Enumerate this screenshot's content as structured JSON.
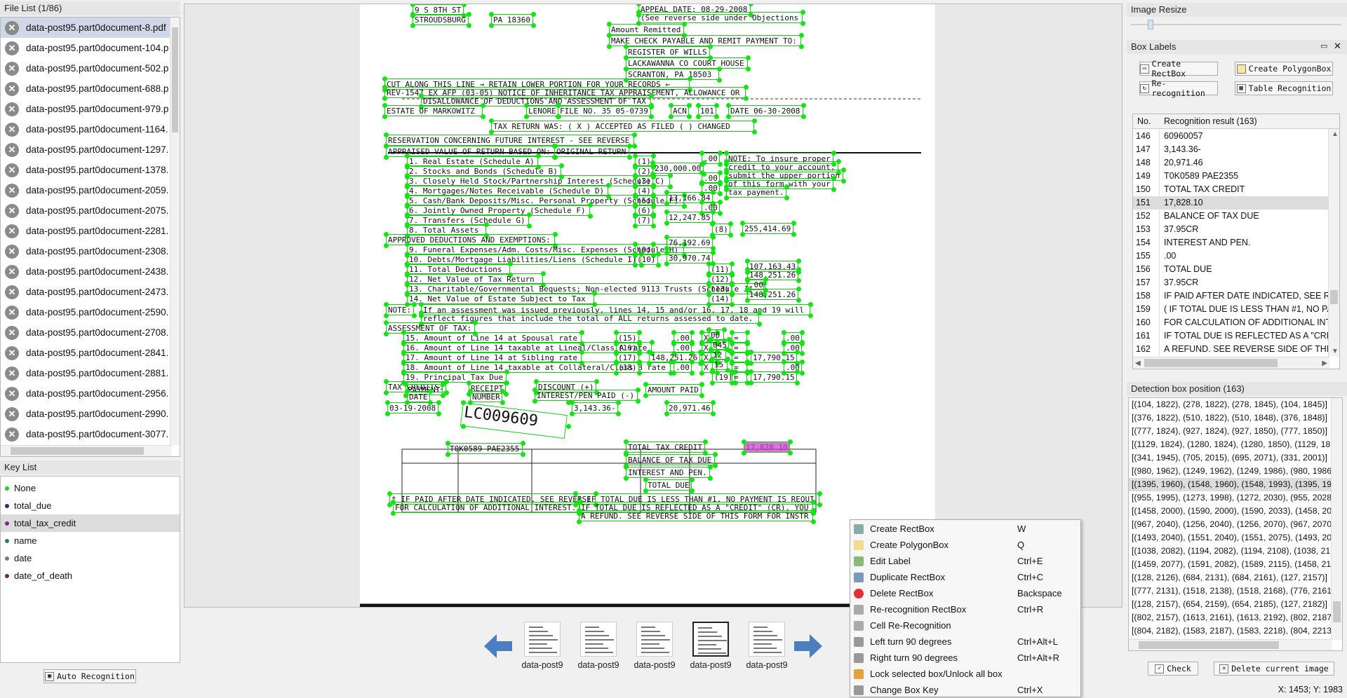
{
  "file_list": {
    "title": "File List (1/86)",
    "items": [
      "data-post95.part0document-8.pdf",
      "data-post95.part0document-104.p",
      "data-post95.part0document-502.p",
      "data-post95.part0document-688.p",
      "data-post95.part0document-979.p",
      "data-post95.part0document-1164.",
      "data-post95.part0document-1297.",
      "data-post95.part0document-1378.",
      "data-post95.part0document-2059.",
      "data-post95.part0document-2075.",
      "data-post95.part0document-2281.",
      "data-post95.part0document-2308.",
      "data-post95.part0document-2438.",
      "data-post95.part0document-2473.",
      "data-post95.part0document-2590.",
      "data-post95.part0document-2708.",
      "data-post95.part0document-2841.",
      "data-post95.part0document-2881.",
      "data-post95.part0document-2956.",
      "data-post95.part0document-2990.",
      "data-post95.part0document-3077."
    ]
  },
  "key_list": {
    "title": "Key List",
    "items": [
      {
        "label": "None",
        "color": "#22cc22"
      },
      {
        "label": "total_due",
        "color": "#2a2a7a"
      },
      {
        "label": "total_tax_credit",
        "color": "#7a2a7a"
      },
      {
        "label": "name",
        "color": "#2a7a7a"
      },
      {
        "label": "date",
        "color": "#7a7a7a"
      },
      {
        "label": "date_of_death",
        "color": "#7a2a2a"
      }
    ]
  },
  "auto_recognition": "Auto Recognition",
  "image_resize": {
    "title": "Image Resize"
  },
  "box_labels": {
    "title": "Box Labels",
    "create_rectbox": "Create RectBox",
    "create_polygonbox": "Create PolygonBox",
    "re_recognition": "Re-recognition",
    "table_recognition": "Table Recognition",
    "col_no": "No.",
    "col_result": "Recognition result (163)",
    "rows": [
      {
        "no": "146",
        "text": "60960057"
      },
      {
        "no": "147",
        "text": "3,143.36-"
      },
      {
        "no": "148",
        "text": "20,971.46"
      },
      {
        "no": "149",
        "text": "T0K0589 PAE2355"
      },
      {
        "no": "150",
        "text": "TOTAL TAX CREDIT"
      },
      {
        "no": "151",
        "text": "17,828.10"
      },
      {
        "no": "152",
        "text": "BALANCE OF TAX DUE"
      },
      {
        "no": "153",
        "text": "37.95CR"
      },
      {
        "no": "154",
        "text": "INTEREST AND PEN."
      },
      {
        "no": "155",
        "text": ".00"
      },
      {
        "no": "156",
        "text": "TOTAL DUE"
      },
      {
        "no": "157",
        "text": "37.95CR"
      },
      {
        "no": "158",
        "text": "IF PAID AFTER DATE INDICATED, SEE RE"
      },
      {
        "no": "159",
        "text": "( IF TOTAL DUE IS LESS THAN #1, NO PA"
      },
      {
        "no": "160",
        "text": "FOR CALCULATION OF ADDITIONAL INT"
      },
      {
        "no": "161",
        "text": "IF TOTAL DUE IS REFLECTED AS A \"CRED"
      },
      {
        "no": "162",
        "text": "A REFUND. SEE REVERSE SIDE OF THIS"
      }
    ]
  },
  "detection": {
    "title": "Detection box position (163)",
    "rows": [
      "[(104, 1822), (278, 1822), (278, 1845), (104, 1845)]",
      "[(376, 1822), (510, 1822), (510, 1848), (376, 1848)]",
      "[(777, 1824), (927, 1824), (927, 1850), (777, 1850)]",
      "[(1129, 1824), (1280, 1824), (1280, 1850), (1129, 18",
      "[(341, 1945), (705, 2015), (695, 2071), (331, 2001)]",
      "[(980, 1962), (1249, 1962), (1249, 1986), (980, 1986",
      "[(1395, 1960), (1548, 1960), (1548, 1993), (1395, 19",
      "[(955, 1995), (1273, 1998), (1272, 2030), (955, 2028",
      "[(1458, 2000), (1590, 2000), (1590, 2033), (1458, 20",
      "[(967, 2040), (1256, 2040), (1256, 2070), (967, 2070",
      "[(1493, 2040), (1551, 2040), (1551, 2075), (1493, 20",
      "[(1038, 2082), (1194, 2082), (1194, 2108), (1038, 21",
      "[(1459, 2077), (1591, 2082), (1589, 2115), (1458, 21",
      "[(128, 2126), (684, 2131), (684, 2161), (127, 2157)]",
      "[(777, 2131), (1518, 2138), (1518, 2168), (776, 2161",
      "[(128, 2157), (654, 2159), (654, 2185), (127, 2182)]",
      "[(802, 2157), (1613, 2161), (1613, 2192), (802, 2187",
      "[(804, 2182), (1583, 2187), (1583, 2218), (804, 2213"
    ]
  },
  "check_button": "Check",
  "delete_button": "Delete current image",
  "status": "X: 1453; Y: 1983",
  "thumbnails": [
    "data-post9",
    "data-post9",
    "data-post9",
    "data-post9",
    "data-post9"
  ],
  "context_menu": [
    {
      "label": "Create RectBox",
      "shortcut": "W",
      "icon": "rectbox-icon"
    },
    {
      "label": "Create PolygonBox",
      "shortcut": "Q",
      "icon": "polygon-icon"
    },
    {
      "label": "Edit Label",
      "shortcut": "Ctrl+E",
      "icon": "edit-icon"
    },
    {
      "label": "Duplicate RectBox",
      "shortcut": "Ctrl+C",
      "icon": "duplicate-icon"
    },
    {
      "label": "Delete RectBox",
      "shortcut": "Backspace",
      "icon": "delete-icon"
    },
    {
      "label": "Re-recognition RectBox",
      "shortcut": "Ctrl+R",
      "icon": "rerecognize-icon"
    },
    {
      "label": "Cell Re-Recognition",
      "shortcut": "",
      "icon": "cell-icon"
    },
    {
      "label": "Left turn 90 degrees",
      "shortcut": "Ctrl+Alt+L",
      "icon": "rotate-left-icon"
    },
    {
      "label": "Right turn 90 degrees",
      "shortcut": "Ctrl+Alt+R",
      "icon": "rotate-right-icon"
    },
    {
      "label": "Lock selected box/Unlock all box",
      "shortcut": "",
      "icon": "lock-icon"
    },
    {
      "label": "Change Box Key",
      "shortcut": "Ctrl+X",
      "icon": "key-icon"
    }
  ],
  "document": {
    "lines": [
      "9 S 8TH ST",
      "STROUDSBURG",
      "PA 18360",
      "APPEAL DATE: 08-29-2008",
      "(See reverse side under Objections",
      "Amount Remitted",
      "MAKE CHECK PAYABLE AND REMIT PAYMENT TO:",
      "REGISTER OF WILLS",
      "LACKAWANNA CO COURT HOUSE",
      "SCRANTON, PA  18503",
      "CUT ALONG THIS LINE  →  RETAIN LOWER PORTION FOR YOUR RECORDS  ←",
      "REV-1547 EX AFP (03-05) NOTICE OF INHERITANCE TAX APPRAISEMENT, ALLOWANCE OR",
      "DISALLOWANCE OF DEDUCTIONS AND ASSESSMENT OF TAX",
      "ESTATE OF  MARKOWITZ",
      "LENORE",
      "FILE NO. 35 05-0739",
      "ACN",
      "101",
      "DATE 06-30-2008",
      "TAX RETURN WAS: ( X ) ACCEPTED AS FILED    (  ) CHANGED",
      "RESERVATION CONCERNING FUTURE INTEREST - SEE REVERSE",
      "APPRAISED VALUE OF RETURN BASED ON:",
      "ORIGINAL RETURN",
      "1. Real Estate (Schedule A)",
      "2. Stocks and Bonds (Schedule B)",
      "3. Closely Held Stock/Partnership Interest (Schedule C)",
      "4. Mortgages/Notes Receivable (Schedule D)",
      "5. Cash/Bank Deposits/Misc. Personal Property (Schedule E)",
      "6. Jointly Owned Property (Schedule F)",
      "7. Transfers (Schedule G)",
      "8.  Total Assets",
      "(1)",
      "(2)",
      "(3)",
      "(4)",
      "(5)",
      "(6)",
      "(7)",
      "(8)",
      ".00",
      "230,000.00",
      ".00",
      ".00",
      "13,166.84",
      ".00",
      "12,247.85",
      "255,414.69",
      "NOTE: To insure proper",
      "credit to your account,",
      "submit the upper portion",
      "of this form with your",
      "tax payment.",
      "APPROVED DEDUCTIONS AND EXEMPTIONS:",
      "9. Funeral Expenses/Adm. Costs/Misc. Expenses (Schedule H)",
      "10. Debts/Mortgage Liabilities/Liens (Schedule I)",
      "11.  Total Deductions",
      "12.  Net Value of Tax Return",
      "13.  Charitable/Governmental Bequests; Non-elected 9113 Trusts (Schedule J)",
      "14.  Net Value of Estate Subject to Tax",
      "(9)",
      "(10)",
      "(11)",
      "(12)",
      "(13)",
      "(14)",
      "76,192.69",
      "30,970.74",
      "107,163.43",
      "148,251.26",
      ".00",
      "148,251.26",
      "NOTE:",
      "If an assessment was issued previously, lines 14, 15 and/or 16, 17, 18 and 19 will",
      "reflect figures that include the total of ALL returns assessed to date.",
      "ASSESSMENT OF TAX:",
      "15. Amount of Line 14 at Spousal rate",
      "16. Amount of Line 14 taxable at Lineal/Class A rate",
      "17. Amount of Line 14 at Sibling rate",
      "18. Amount of Line 14 taxable at Collateral/Class B rate",
      "19. Principal Tax Due",
      "(15)",
      "(16)",
      "(17)",
      "(18)",
      "(19)",
      ".00",
      ".00",
      "148,251.26",
      ".00",
      "X",
      "00",
      "X",
      "045",
      "X",
      "12",
      "X",
      "15",
      "=",
      ".00",
      "=",
      ".00",
      "=",
      "17,790.15",
      "=",
      ".00",
      "=",
      "17,790.15",
      "TAX CREDITS:",
      "PAYMENT",
      "DATE",
      "RECEIPT",
      "NUMBER",
      "DISCOUNT (+)",
      "INTEREST/PEN PAID (-)",
      "AMOUNT PAID",
      "03-19-2008",
      "LC009609",
      "3,143.36-",
      "20,971.46",
      "T0K0589 PAE2355",
      "TOTAL TAX CREDIT",
      "17,828.10",
      "BALANCE OF TAX DUE",
      "INTEREST AND PEN.",
      "TOTAL DUE",
      "* IF PAID AFTER DATE INDICATED, SEE REVERSE",
      "FOR CALCULATION OF ADDITIONAL INTEREST.",
      "( IF TOTAL DUE IS LESS THAN #1, NO PAYMENT IS REQUI",
      "IF TOTAL DUE IS REFLECTED AS A \"CREDIT\" (CR), YOU",
      "A REFUND. SEE REVERSE SIDE OF THIS FORM FOR INSTR"
    ]
  }
}
